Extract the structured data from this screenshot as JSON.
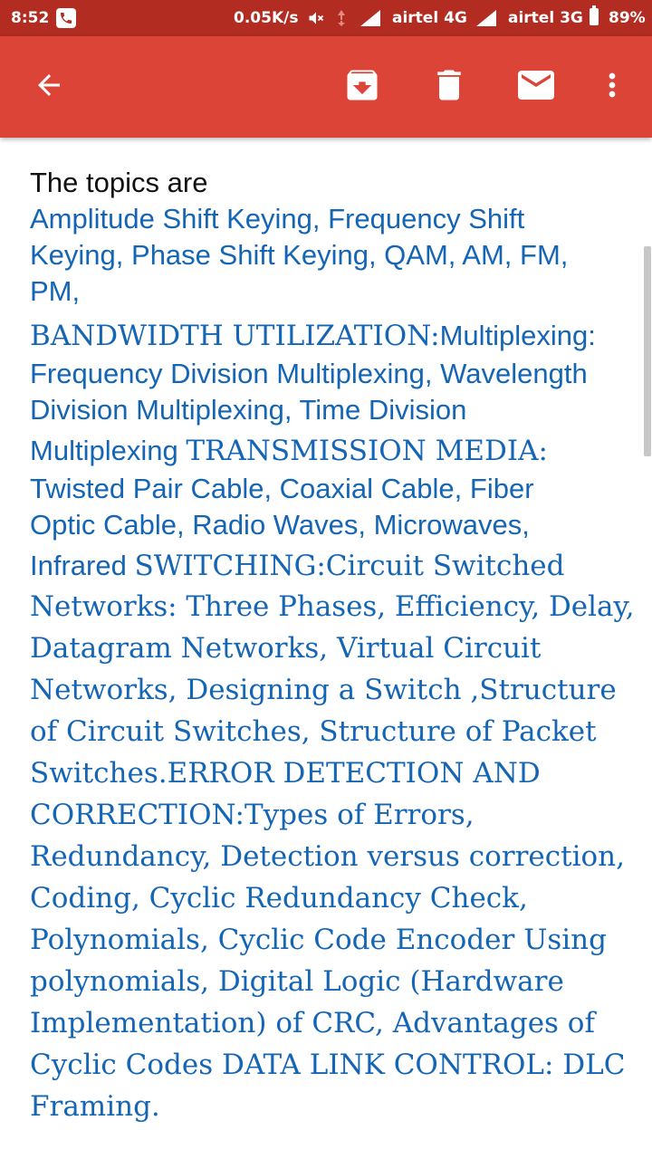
{
  "status_bar": {
    "time": "8:52",
    "net_speed": "0.05K/s",
    "carrier_1": "airtel 4G",
    "carrier_2": "airtel 3G",
    "battery": "89%"
  },
  "toolbar": {
    "icons": [
      "arrow-back-icon",
      "archive-icon",
      "delete-icon",
      "mail-icon",
      "more-vert-icon"
    ]
  },
  "colors": {
    "status_bar": "#b22c21",
    "toolbar": "#db4437",
    "link_text": "#1565b5"
  },
  "message": {
    "intro": "The topics are",
    "lines": [
      "Amplitude Shift Keying, Frequency Shift",
      "Keying, Phase Shift Keying, QAM, AM, FM,",
      "PM,",
      "BANDWIDTH UTILIZATION:",
      "Multiplexing:",
      "Frequency Division Multiplexing, Wavelength",
      "Division Multiplexing, Time Division",
      "Multiplexing ",
      "TRANSMISSION MEDIA:",
      "Twisted Pair Cable, Coaxial Cable, Fiber",
      "Optic Cable, Radio Waves, Microwaves,",
      "Infrared ",
      "SWITCHING:Circuit Switched",
      "Networks: Three Phases, Efficiency, Delay,",
      "Datagram Networks, Virtual Circuit",
      "Networks, Designing a Switch ,Structure",
      "of Circuit Switches, Structure of Packet",
      "Switches.ERROR DETECTION AND",
      "CORRECTION:Types of Errors,",
      "Redundancy, Detection versus correction,",
      "Coding, Cyclic Redundancy Check,",
      "Polynomials, Cyclic Code Encoder Using",
      "polynomials, Digital Logic (Hardware",
      "Implementation) of  CRC, Advantages of",
      "Cyclic Codes DATA LINK CONTROL: DLC",
      "Framing."
    ]
  }
}
